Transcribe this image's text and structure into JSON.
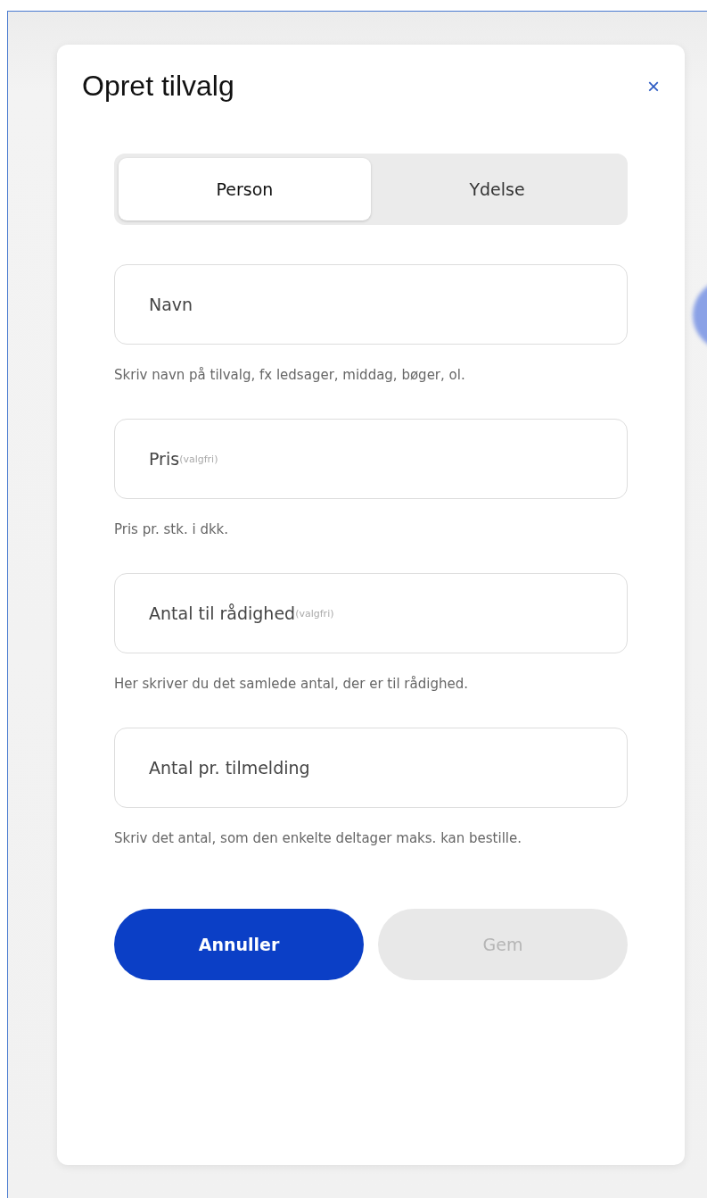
{
  "dialog": {
    "title": "Opret tilvalg",
    "close": "×"
  },
  "tabs": [
    {
      "label": "Person",
      "selected": true
    },
    {
      "label": "Ydelse",
      "selected": false
    }
  ],
  "fields": [
    {
      "label": "Navn",
      "help": "Skriv navn på tilvalg, fx ledsager, middag, bøger, ol."
    },
    {
      "label": "Pris",
      "optional": "(valgfri)",
      "help": "Pris pr. stk. i dkk."
    },
    {
      "label": "Antal til rådighed",
      "optional": "(valgfri)",
      "help": "Her skriver du det samlede antal, der er til rådighed."
    },
    {
      "label": "Antal pr. tilmelding",
      "help": "Skriv det antal, som den enkelte deltager maks. kan bestille."
    }
  ],
  "buttons": [
    {
      "label": "Annuller",
      "kind": "primary",
      "disabled": false
    },
    {
      "label": "Gem",
      "kind": "secondary",
      "disabled": true
    }
  ]
}
